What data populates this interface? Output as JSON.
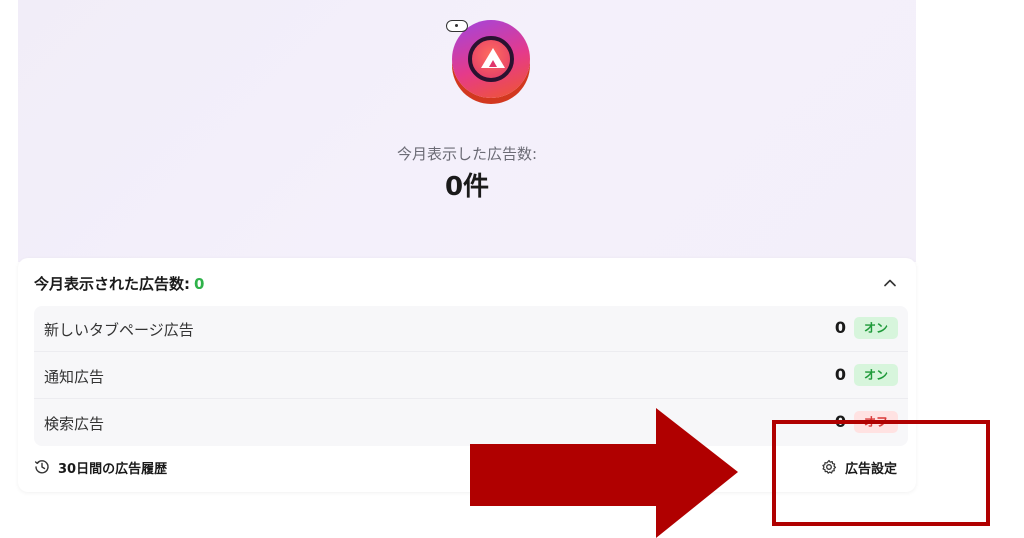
{
  "hero": {
    "caption": "今月表示した広告数:",
    "count": "0件"
  },
  "summary": {
    "header_label": "今月表示された広告数:",
    "header_count": "0",
    "rows": [
      {
        "label": "新しいタブページ広告",
        "value": "0",
        "toggle": "オン",
        "state": "on"
      },
      {
        "label": "通知広告",
        "value": "0",
        "toggle": "オン",
        "state": "on"
      },
      {
        "label": "検索広告",
        "value": "0",
        "toggle": "オフ",
        "state": "off"
      }
    ],
    "history_label": "30日間の広告履歴",
    "settings_label": "広告設定"
  },
  "icons": {
    "logo": "brave-rewards-bat-icon",
    "collapse": "chevron-up-icon",
    "history": "history-clock-icon",
    "settings": "gear-icon",
    "arrow": "arrow-right-annotation",
    "highlight": "highlight-box-annotation"
  },
  "colors": {
    "accent_green": "#2fb24a",
    "toggle_on_bg": "#d7f5dc",
    "toggle_off_bg": "#ffe2e2",
    "annotation_red": "#b00000",
    "hero_bg": "#f2eef9"
  }
}
